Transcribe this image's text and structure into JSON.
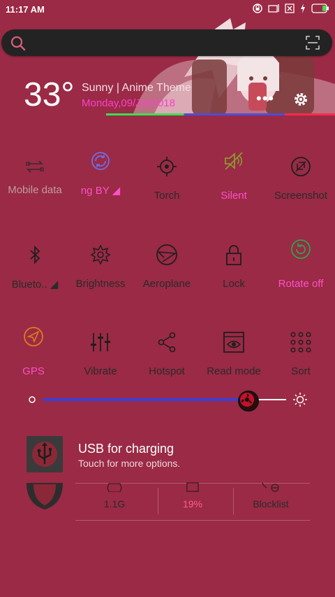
{
  "status_bar": {
    "time": "11:17 AM"
  },
  "search": {
    "placeholder": ""
  },
  "weather": {
    "temperature": "33°",
    "condition": "Sunny | Anime Theme",
    "date": "Monday,09/Jul/2018",
    "more_label": "•••"
  },
  "toggles": [
    {
      "label": "Mobile data",
      "icon": "mobile-data-icon",
      "state": "disabled"
    },
    {
      "label": "ng   BY ◢",
      "icon": "sync-icon",
      "state": "active"
    },
    {
      "label": "Torch",
      "icon": "torch-icon",
      "state": "off"
    },
    {
      "label": "Silent",
      "icon": "silent-icon",
      "state": "active"
    },
    {
      "label": "Screenshot",
      "icon": "screenshot-icon",
      "state": "off"
    },
    {
      "label": "Blueto.. ◢",
      "icon": "bluetooth-icon",
      "state": "off"
    },
    {
      "label": "Brightness",
      "icon": "brightness-icon",
      "state": "off"
    },
    {
      "label": "Aeroplane",
      "icon": "aeroplane-icon",
      "state": "off"
    },
    {
      "label": "Lock",
      "icon": "lock-icon",
      "state": "off"
    },
    {
      "label": "Rotate off",
      "icon": "rotate-icon",
      "state": "active"
    },
    {
      "label": "GPS",
      "icon": "gps-icon",
      "state": "active"
    },
    {
      "label": "Vibrate",
      "icon": "vibrate-icon",
      "state": "off"
    },
    {
      "label": "Hotspot",
      "icon": "hotspot-icon",
      "state": "off"
    },
    {
      "label": "Read mode",
      "icon": "read-mode-icon",
      "state": "off"
    },
    {
      "label": "Sort",
      "icon": "sort-icon",
      "state": "off"
    }
  ],
  "brightness": {
    "level": 0.84
  },
  "notification": {
    "title": "USB for charging",
    "subtitle": "Touch for more options."
  },
  "stats": [
    {
      "value": "1.1G"
    },
    {
      "value": "19%"
    },
    {
      "value": "Blocklist"
    }
  ],
  "colors": {
    "accent_pink": "#ff4fcc",
    "background": "#9a2a45"
  }
}
